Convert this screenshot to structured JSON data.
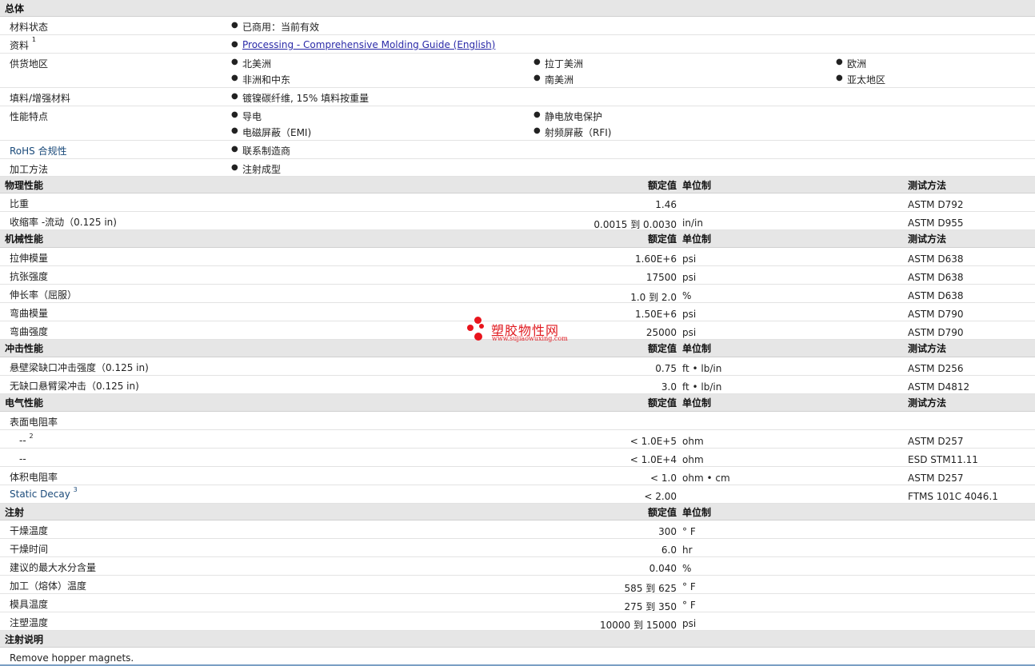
{
  "general": {
    "title": "总体",
    "status": {
      "label": "材料状态",
      "value": "已商用：当前有效"
    },
    "docs": {
      "label": "资料",
      "sup": "1",
      "link": "Processing - Comprehensive Molding Guide (English)"
    },
    "regions": {
      "label": "供货地区",
      "items": [
        "北美洲",
        "拉丁美洲",
        "欧洲",
        "非洲和中东",
        "南美洲",
        "亚太地区"
      ]
    },
    "filler": {
      "label": "填料/增强材料",
      "value": "镀镍碳纤维, 15% 填料按重量"
    },
    "features": {
      "label": "性能特点",
      "items": [
        "导电",
        "静电放电保护",
        "电磁屏蔽（EMI)",
        "射频屏蔽（RFI)"
      ]
    },
    "rohs": {
      "label": "RoHS 合规性",
      "value": "联系制造商"
    },
    "method": {
      "label": "加工方法",
      "value": "注射成型"
    }
  },
  "columns": {
    "value": "额定值",
    "unit": "单位制",
    "test": "测试方法"
  },
  "sections": [
    {
      "title": "物理性能",
      "show_test": true,
      "rows": [
        {
          "label": "比重",
          "value": "1.46",
          "unit": "",
          "test": "ASTM D792"
        },
        {
          "label": "收缩率 -流动（0.125 in)",
          "value": "0.0015 到 0.0030",
          "unit": "in/in",
          "test": "ASTM D955"
        }
      ]
    },
    {
      "title": "机械性能",
      "show_test": true,
      "rows": [
        {
          "label": "拉伸模量",
          "value": "1.60E+6",
          "unit": "psi",
          "test": "ASTM D638"
        },
        {
          "label": "抗张强度",
          "value": "17500",
          "unit": "psi",
          "test": "ASTM D638"
        },
        {
          "label": "伸长率（屈服）",
          "value": "1.0 到 2.0",
          "unit": "%",
          "test": "ASTM D638"
        },
        {
          "label": "弯曲模量",
          "value": "1.50E+6",
          "unit": "psi",
          "test": "ASTM D790"
        },
        {
          "label": "弯曲强度",
          "value": "25000",
          "unit": "psi",
          "test": "ASTM D790"
        }
      ]
    },
    {
      "title": "冲击性能",
      "show_test": true,
      "rows": [
        {
          "label": "悬壁梁缺口冲击强度（0.125 in)",
          "value": "0.75",
          "unit": "ft • lb/in",
          "test": "ASTM D256"
        },
        {
          "label": "无缺口悬臂梁冲击（0.125 in)",
          "value": "3.0",
          "unit": "ft • lb/in",
          "test": "ASTM D4812"
        }
      ]
    },
    {
      "title": "电气性能",
      "show_test": true,
      "rows": [
        {
          "label": "表面电阻率",
          "value": "",
          "unit": "",
          "test": ""
        },
        {
          "label": "--",
          "sup": "2",
          "indent": true,
          "value": "< 1.0E+5",
          "unit": "ohm",
          "test": "ASTM D257"
        },
        {
          "label": "--",
          "indent": true,
          "value": "< 1.0E+4",
          "unit": "ohm",
          "test": "ESD STM11.11"
        },
        {
          "label": "体积电阻率",
          "value": "< 1.0",
          "unit": "ohm • cm",
          "test": "ASTM D257"
        },
        {
          "label": "Static Decay",
          "sup": "3",
          "blue": true,
          "value": "< 2.00",
          "unit": "",
          "test": "FTMS 101C 4046.1"
        }
      ]
    },
    {
      "title": "注射",
      "show_test": false,
      "rows": [
        {
          "label": "干燥温度",
          "value": "300",
          "unit": "° F",
          "test": ""
        },
        {
          "label": "干燥时间",
          "value": "6.0",
          "unit": "hr",
          "test": ""
        },
        {
          "label": "建议的最大水分含量",
          "value": "0.040",
          "unit": "%",
          "test": ""
        },
        {
          "label": "加工（熔体）温度",
          "value": "585 到 625",
          "unit": "° F",
          "test": ""
        },
        {
          "label": "模具温度",
          "value": "275 到 350",
          "unit": "° F",
          "test": ""
        },
        {
          "label": "注塑温度",
          "value": "10000 到 15000",
          "unit": "psi",
          "test": ""
        }
      ]
    }
  ],
  "notes": {
    "title": "注射说明",
    "text": "Remove hopper magnets."
  },
  "watermark": {
    "cn": "塑胶物性网",
    "en": "www.sujiaowuxing.com",
    "color": "#e0191f"
  }
}
